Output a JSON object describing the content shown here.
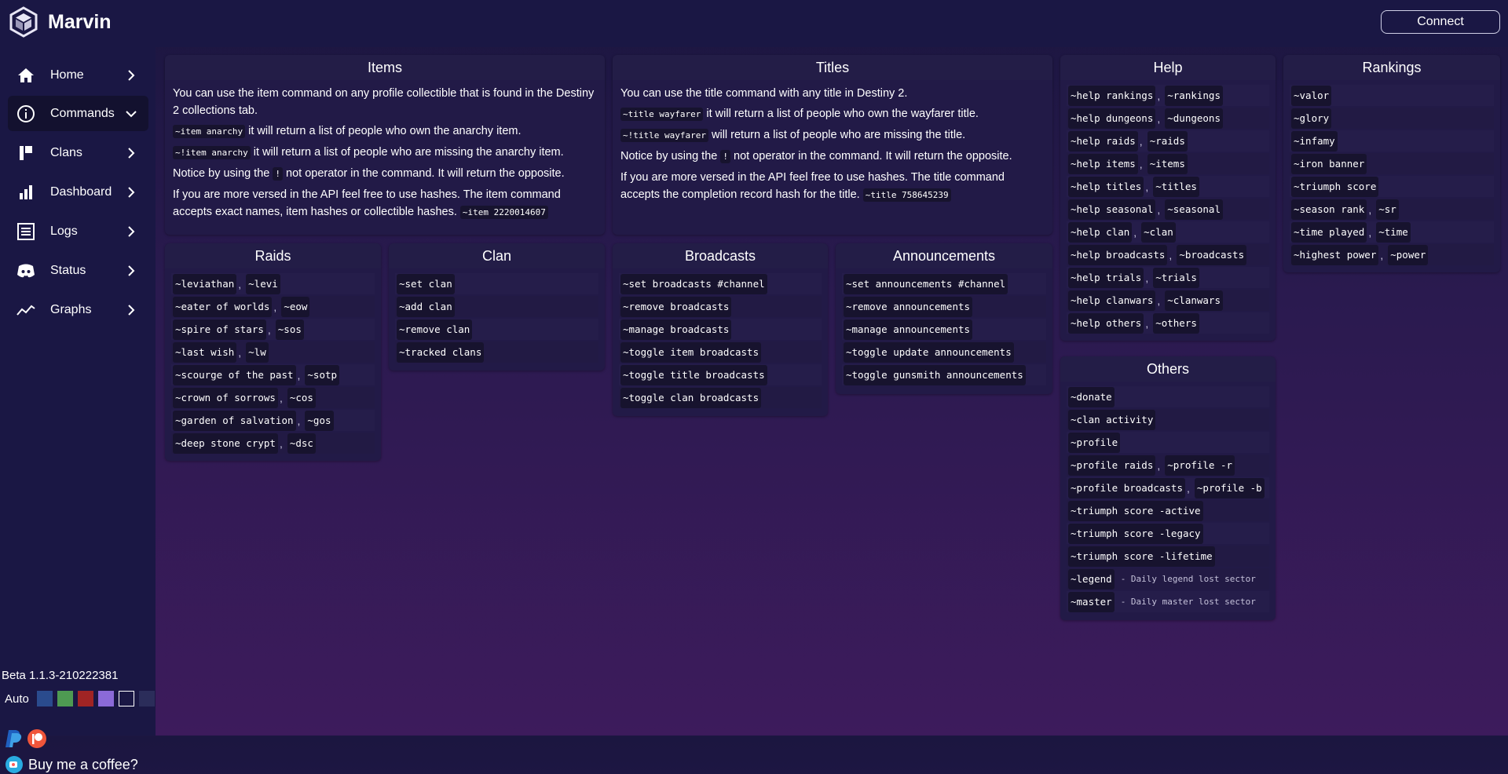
{
  "brand": {
    "name": "Marvin"
  },
  "header": {
    "connect_label": "Connect"
  },
  "sidebar": {
    "items": [
      {
        "label": "Home",
        "icon": "home-icon"
      },
      {
        "label": "Commands",
        "icon": "info-icon"
      },
      {
        "label": "Clans",
        "icon": "banner-icon"
      },
      {
        "label": "Dashboard",
        "icon": "bar-chart-icon"
      },
      {
        "label": "Logs",
        "icon": "logs-icon"
      },
      {
        "label": "Status",
        "icon": "discord-icon"
      },
      {
        "label": "Graphs",
        "icon": "line-graph-icon"
      }
    ],
    "version": "Beta 1.1.3-210222381",
    "theme_auto_label": "Auto",
    "theme_swatches": [
      "#2a4b8d",
      "#4e9a52",
      "#a02424",
      "#8b6ad8",
      "#1a1744",
      "#2b2d5a"
    ],
    "coffee_label": "Buy me a coffee?"
  },
  "items_card": {
    "title": "Items",
    "p1": "You can use the item command on any profile collectible that is found in the Destiny 2 collections tab.",
    "ex1_code": "~item anarchy",
    "ex1_text": " it will return a list of people who own the anarchy item.",
    "ex2_code": "~!item anarchy",
    "ex2_text": " it will return a list of people who are missing the anarchy item.",
    "p3a": "Notice by using the ",
    "p3_code": "!",
    "p3b": " not operator in the command. It will return the opposite.",
    "p4": "If you are more versed in the API feel free to use hashes. The item command accepts exact names, item hashes or collectible hashes. ",
    "p4_code": "~item 2220014607"
  },
  "titles_card": {
    "title": "Titles",
    "p1": "You can use the title command with any title in Destiny 2.",
    "ex1_code": "~title wayfarer",
    "ex1_text": " it will return a list of people who own the wayfarer title.",
    "ex2_code": "~!title wayfarer",
    "ex2_text": " will return a list of people who are missing the title.",
    "p3a": "Notice by using the ",
    "p3_code": "!",
    "p3b": " not operator in the command. It will return the opposite.",
    "p4": "If you are more versed in the API feel free to use hashes. The title command accepts the completion record hash for the title. ",
    "p4_code": "~title 758645239"
  },
  "help_card": {
    "title": "Help",
    "rows": [
      [
        "~help rankings",
        "~rankings"
      ],
      [
        "~help dungeons",
        "~dungeons"
      ],
      [
        "~help raids",
        "~raids"
      ],
      [
        "~help items",
        "~items"
      ],
      [
        "~help titles",
        "~titles"
      ],
      [
        "~help seasonal",
        "~seasonal"
      ],
      [
        "~help clan",
        "~clan"
      ],
      [
        "~help broadcasts",
        "~broadcasts"
      ],
      [
        "~help trials",
        "~trials"
      ],
      [
        "~help clanwars",
        "~clanwars"
      ],
      [
        "~help others",
        "~others"
      ]
    ]
  },
  "rankings_card": {
    "title": "Rankings",
    "rows": [
      [
        "~valor"
      ],
      [
        "~glory"
      ],
      [
        "~infamy"
      ],
      [
        "~iron banner"
      ],
      [
        "~triumph score"
      ],
      [
        "~season rank",
        "~sr"
      ],
      [
        "~time played",
        "~time"
      ],
      [
        "~highest power",
        "~power"
      ]
    ]
  },
  "raids_card": {
    "title": "Raids",
    "rows": [
      [
        "~leviathan",
        "~levi"
      ],
      [
        "~eater of worlds",
        "~eow"
      ],
      [
        "~spire of stars",
        "~sos"
      ],
      [
        "~last wish",
        "~lw"
      ],
      [
        "~scourge of the past",
        "~sotp"
      ],
      [
        "~crown of sorrows",
        "~cos"
      ],
      [
        "~garden of salvation",
        "~gos"
      ],
      [
        "~deep stone crypt",
        "~dsc"
      ]
    ]
  },
  "clan_card": {
    "title": "Clan",
    "rows": [
      [
        "~set clan"
      ],
      [
        "~add clan"
      ],
      [
        "~remove clan"
      ],
      [
        "~tracked clans"
      ]
    ]
  },
  "broadcasts_card": {
    "title": "Broadcasts",
    "rows": [
      [
        "~set broadcasts #channel"
      ],
      [
        "~remove broadcasts"
      ],
      [
        "~manage broadcasts"
      ],
      [
        "~toggle item broadcasts"
      ],
      [
        "~toggle title broadcasts"
      ],
      [
        "~toggle clan broadcasts"
      ]
    ]
  },
  "announcements_card": {
    "title": "Announcements",
    "rows": [
      [
        "~set announcements #channel"
      ],
      [
        "~remove announcements"
      ],
      [
        "~manage announcements"
      ],
      [
        "~toggle update announcements"
      ],
      [
        "~toggle gunsmith announcements"
      ]
    ]
  },
  "others_card": {
    "title": "Others",
    "rows": [
      [
        "~donate"
      ],
      [
        "~clan activity"
      ],
      [
        "~profile"
      ],
      [
        "~profile raids",
        "~profile -r"
      ],
      [
        "~profile broadcasts",
        "~profile -b"
      ],
      [
        "~triumph score -active"
      ],
      [
        "~triumph score -legacy"
      ],
      [
        "~triumph score -lifetime"
      ]
    ],
    "desc_rows": [
      {
        "cmd": "~legend",
        "desc": "- Daily legend lost sector"
      },
      {
        "cmd": "~master",
        "desc": "- Daily master lost sector"
      }
    ]
  }
}
